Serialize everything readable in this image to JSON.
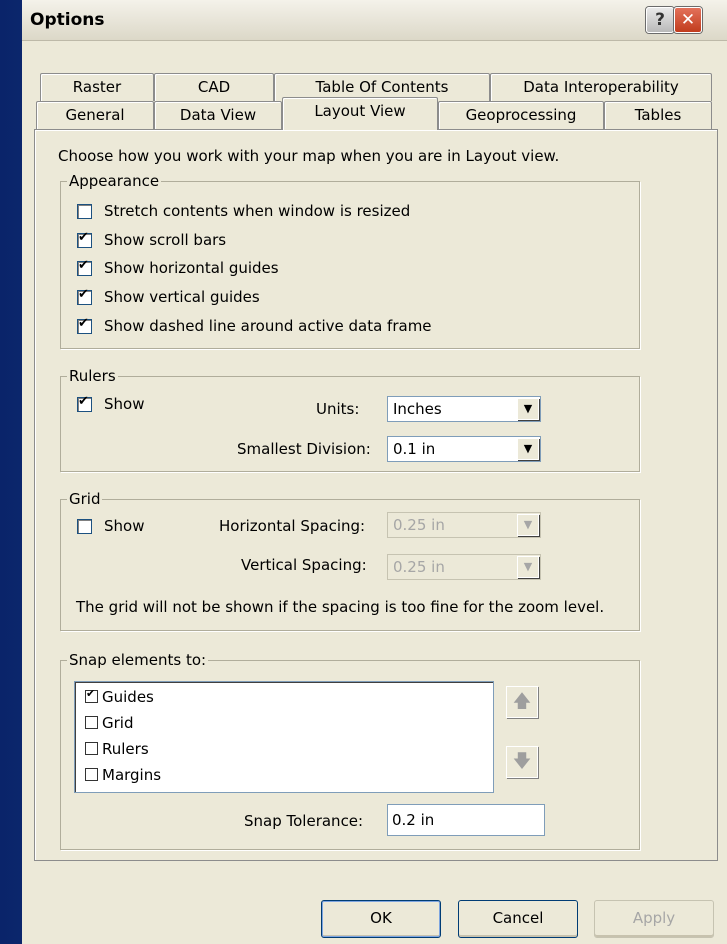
{
  "window": {
    "title": "Options",
    "help_glyph": "?",
    "close_glyph": "✕"
  },
  "tabs_row1": [
    "Raster",
    "CAD",
    "Table Of Contents",
    "Data Interoperability"
  ],
  "tabs_row2": [
    "General",
    "Data View",
    "Layout View",
    "Geoprocessing",
    "Tables"
  ],
  "active_tab": "Layout View",
  "intro": "Choose how you work with your map when you are in Layout view.",
  "appearance": {
    "legend": "Appearance",
    "items": [
      {
        "label": "Stretch contents when window is resized",
        "checked": false
      },
      {
        "label": "Show scroll bars",
        "checked": true
      },
      {
        "label": "Show horizontal guides",
        "checked": true
      },
      {
        "label": "Show vertical guides",
        "checked": true
      },
      {
        "label": "Show dashed line around active data frame",
        "checked": true
      }
    ]
  },
  "rulers": {
    "legend": "Rulers",
    "show_label": "Show",
    "show_checked": true,
    "units_label": "Units:",
    "units_value": "Inches",
    "division_label": "Smallest Division:",
    "division_value": "0.1 in"
  },
  "grid": {
    "legend": "Grid",
    "show_label": "Show",
    "show_checked": false,
    "hspacing_label": "Horizontal Spacing:",
    "hspacing_value": "0.25 in",
    "vspacing_label": "Vertical Spacing:",
    "vspacing_value": "0.25 in",
    "note": "The grid will not be shown if the spacing is too fine for the zoom level."
  },
  "snap": {
    "legend": "Snap elements to:",
    "items": [
      {
        "label": "Guides",
        "checked": true
      },
      {
        "label": "Grid",
        "checked": false
      },
      {
        "label": "Rulers",
        "checked": false
      },
      {
        "label": "Margins",
        "checked": false
      }
    ],
    "up_glyph": "🡅",
    "down_glyph": "🡇",
    "tolerance_label": "Snap Tolerance:",
    "tolerance_value": "0.2 in"
  },
  "buttons": {
    "ok": "OK",
    "cancel": "Cancel",
    "apply": "Apply"
  }
}
